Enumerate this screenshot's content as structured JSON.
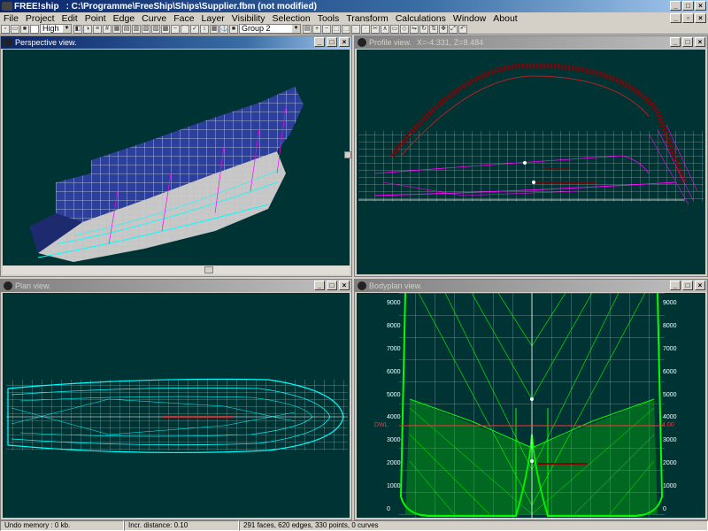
{
  "window": {
    "app_name": "FREE!ship",
    "title_path": ": C:\\Programme\\FreeShip\\Ships\\Supplier.fbm (not modified)"
  },
  "menu": [
    "File",
    "Project",
    "Edit",
    "Point",
    "Edge",
    "Curve",
    "Face",
    "Layer",
    "Visibility",
    "Selection",
    "Tools",
    "Transform",
    "Calculations",
    "Window",
    "About"
  ],
  "toolbar": {
    "precision": "High",
    "layer": "Group 2"
  },
  "views": {
    "perspective": {
      "title": "Perspective view."
    },
    "profile": {
      "title": "Profile view.",
      "coords": "X=-4.331, Z=8.484"
    },
    "plan": {
      "title": "Plan view."
    },
    "bodyplan": {
      "title": "Bodyplan view.",
      "left_ticks": [
        "9000",
        "8000",
        "7000",
        "6000",
        "5000",
        "4000",
        "3000",
        "2000",
        "1000",
        "0"
      ],
      "right_ticks": [
        "9000",
        "8000",
        "7000",
        "6000",
        "5000",
        "4000",
        "3000",
        "2000",
        "1000",
        "0"
      ],
      "dwl_label": "DWL",
      "dwl_value": "4.00"
    }
  },
  "statusbar": {
    "undo": "Undo memory : 0 kb.",
    "distance": "Incr. distance: 0.10",
    "counts": "291 faces, 620 edges, 330 points, 0 curves"
  },
  "colors": {
    "viewport_bg": "#003333",
    "hull_grid": "#d0d0d0",
    "waterline": "#00ffff",
    "station": "#ff00ff",
    "bodyplan_lines": "#00ff00",
    "profile_lines": "#8b0000"
  }
}
